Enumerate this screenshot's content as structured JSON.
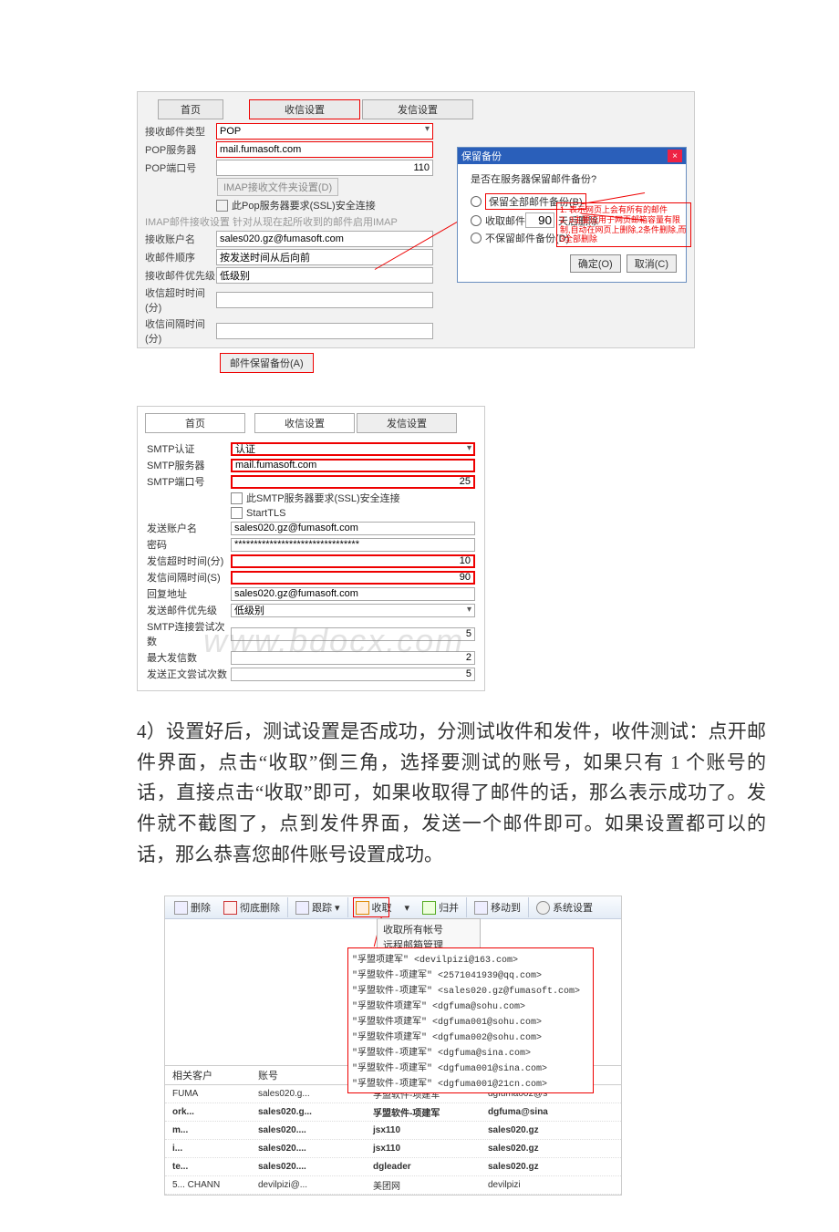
{
  "pop": {
    "tabs": {
      "home": "首页",
      "rx": "收信设置",
      "tx": "发信设置"
    },
    "labels": {
      "mail_type": "接收邮件类型",
      "pop_server": "POP服务器",
      "pop_port": "POP端口号",
      "imap_btn": "IMAP接收文件夹设置(D)",
      "ssl_check": "此Pop服务器要求(SSL)安全连接",
      "imap_note": "IMAP邮件接收设置 针对从现在起所收到的邮件启用IMAP",
      "acct": "接收账户名",
      "order": "收邮件顺序",
      "priority": "接收邮件优先级",
      "timeout": "收信超时时间(分)",
      "interval": "收信间隔时间(分)",
      "backup_btn": "邮件保留备份(A)"
    },
    "values": {
      "mail_type": "POP",
      "pop_server": "mail.fumasoft.com",
      "pop_port": "110",
      "acct": "sales020.gz@fumasoft.com",
      "order": "按发送时间从后向前",
      "priority": "低级别"
    },
    "dialog": {
      "title": "保留备份",
      "q": "是否在服务器保留邮件备份?",
      "opt1": "保留全部邮件备份(B)",
      "opt2_a": "收取邮件",
      "opt2_days": "90",
      "opt2_b": "天后删除",
      "opt3": "不保留邮件备份(D)",
      "ok": "确定(O)",
      "cancel": "取消(C)"
    },
    "legend": "1. 表示网页上会有所有的邮件\n2. 3主要应用于网页邮箱容量有限制,自动在网页上删除,2条件删除,而3全部删除"
  },
  "smtp": {
    "tabs": {
      "home": "首页",
      "rx": "收信设置",
      "tx": "发信设置"
    },
    "labels": {
      "auth": "SMTP认证",
      "server": "SMTP服务器",
      "port": "SMTP端口号",
      "ssl": "此SMTP服务器要求(SSL)安全连接",
      "starttls": "StartTLS",
      "acct": "发送账户名",
      "pwd": "密码",
      "timeout": "发信超时时间(分)",
      "interval": "发信间隔时间(S)",
      "reply": "回复地址",
      "priority": "发送邮件优先级",
      "retry": "SMTP连接尝试次数",
      "maxsend": "最大发信数",
      "bodyretry": "发送正文尝试次数"
    },
    "values": {
      "auth": "认证",
      "server": "mail.fumasoft.com",
      "port": "25",
      "acct": "sales020.gz@fumasoft.com",
      "pwd": "********************************",
      "timeout": "10",
      "interval": "90",
      "reply": "sales020.gz@fumasoft.com",
      "priority": "低级别",
      "retry": "5",
      "maxsend": "2",
      "bodyretry": "5"
    },
    "watermark": "www.bdocx.com"
  },
  "body_text": "4）设置好后，测试设置是否成功，分测试收件和发件，收件测试：点开邮件界面，点击“收取”倒三角，选择要测试的账号，如果只有 1 个账号的话，直接点击“收取”即可，如果收取得了邮件的话，那么表示成功了。发件就不截图了，点到发件界面，发送一个邮件即可。如果设置都可以的话，那么恭喜您邮件账号设置成功。",
  "mail": {
    "toolbar": {
      "del": "删除",
      "harddel": "彻底删除",
      "track": "跟踪",
      "recv": "收取",
      "merge": "归并",
      "move": "移动到",
      "sys": "系统设置"
    },
    "dropdown": {
      "all": "收取所有帐号",
      "remote": "远程邮箱管理"
    },
    "accounts": [
      "\"孚盟项建军\" <devilpizi@163.com>",
      "\"孚盟软件-项建军\" <2571041939@qq.com>",
      "\"孚盟软件-项建军\" <sales020.gz@fumasoft.com>",
      "\"孚盟软件项建军\" <dgfuma@sohu.com>",
      "\"孚盟软件项建军\" <dgfuma001@sohu.com>",
      "\"孚盟软件项建军\" <dgfuma002@sohu.com>",
      "\"孚盟软件-项建军\" <dgfuma@sina.com>",
      "\"孚盟软件-项建军\" <dgfuma001@sina.com>",
      "\"孚盟软件-项建军\" <dgfuma001@21cn.com>"
    ],
    "table": {
      "cols": {
        "c1": "相关客户",
        "c2": "账号"
      },
      "rows": [
        {
          "c1": "FUMA",
          "c2": "sales020.g...",
          "c3": "孚盟软件-项建军",
          "c4": "dgfuma002@s"
        },
        {
          "c1": "ork...",
          "c2": "sales020.g...",
          "c3": "孚盟软件-项建军",
          "c4": "dgfuma@sina"
        },
        {
          "c1": "m...",
          "c2": "sales020....",
          "c3": "jsx110",
          "c4": "sales020.gz"
        },
        {
          "c1": "i...",
          "c2": "sales020....",
          "c3": "jsx110",
          "c4": "sales020.gz"
        },
        {
          "c1": "te...",
          "c2": "sales020....",
          "c3": "dgleader",
          "c4": "sales020.gz"
        },
        {
          "c1": "5... CHANN",
          "c2": "devilpizi@...",
          "c3": "美团网",
          "c4": "devilpizi"
        }
      ]
    }
  }
}
